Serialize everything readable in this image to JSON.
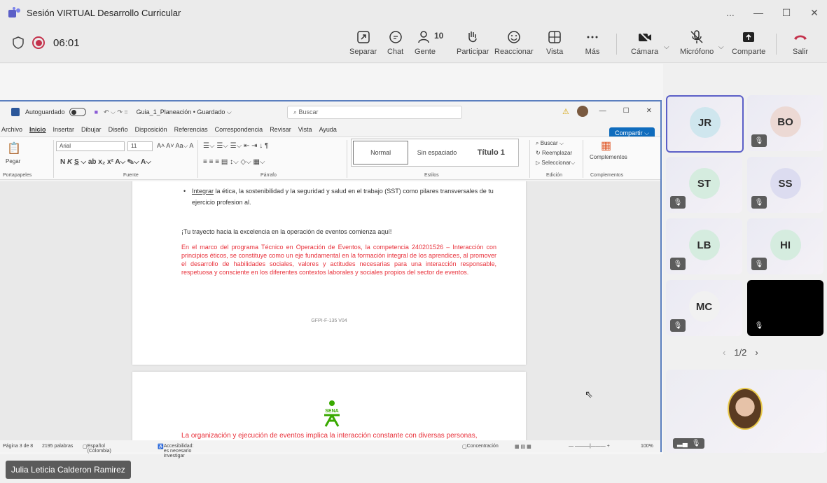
{
  "window": {
    "title": "Sesión VIRTUAL Desarrollo Curricular",
    "controls": [
      "...",
      "—",
      "☐",
      "✕"
    ]
  },
  "meeting": {
    "timer": "06:01",
    "buttons": {
      "separar": "Separar",
      "chat": "Chat",
      "gente": "Gente",
      "gente_count": "10",
      "participar": "Participar",
      "reaccionar": "Reaccionar",
      "vista": "Vista",
      "mas": "Más",
      "camara": "Cámara",
      "microfono": "Micrófono",
      "comparte": "Comparte",
      "salir": "Salir"
    }
  },
  "word": {
    "autosave": "Autoguardado",
    "doc_title": "Guia_1_Planeación • Guardado ⌵",
    "search_placeholder": "Buscar",
    "menu": [
      "Archivo",
      "Inicio",
      "Insertar",
      "Dibujar",
      "Diseño",
      "Disposición",
      "Referencias",
      "Correspondencia",
      "Revisar",
      "Vista",
      "Ayuda"
    ],
    "share": "Compartir",
    "ribbon": {
      "paste": "Pegar",
      "font": "Arial",
      "size": "11",
      "styles": [
        "Normal",
        "Sin espaciado",
        "Título 1"
      ],
      "search": "Buscar",
      "replace": "Reemplazar",
      "select": "Seleccionar",
      "addins": "Complementos",
      "groups": [
        "Portapapeles",
        "Fuente",
        "Párrafo",
        "Estilos",
        "Edición",
        "Complementos"
      ]
    },
    "doc": {
      "bullet_prefix": "Integrar",
      "bullet_text": "la ética, la sostenibilidad y la seguridad y salud en el trabajo (SST) como pilares transversales de tu ejercicio profesion al.",
      "tagline": "¡Tu trayecto hacia la excelencia en la operación de eventos comienza aquí!",
      "red_para": "En el marco del programa Técnico en Operación de Eventos, la competencia 240201526 – Interacción con principios éticos, se constituye como un eje fundamental en la formación integral de los aprendices, al promover el desarrollo de habilidades sociales, valores y actitudes necesarias para una interacción responsable, respetuosa y consciente en los diferentes contextos laborales y sociales propios del sector de eventos.",
      "footer_code": "GFPI-F-135 V04",
      "sena_logo": "SENA",
      "page2_text": "La organización y ejecución de eventos implica la interacción constante con diversas personas,"
    },
    "status": {
      "page": "Página 3 de 8",
      "words": "2195 palabras",
      "lang": "Español (Colombia)",
      "access": "Accesibilidad: es necesario investigar",
      "focus": "Concentración",
      "zoom": "100%"
    }
  },
  "presenter_name": "Julia Leticia Calderon Ramirez",
  "participants": [
    {
      "initials": "JR",
      "color": "#cfe6ee"
    },
    {
      "initials": "BO",
      "color": "#ecd9d4"
    },
    {
      "initials": "ST",
      "color": "#d5ecdf"
    },
    {
      "initials": "SS",
      "color": "#dcdcf0"
    },
    {
      "initials": "LB",
      "color": "#d5ecdf"
    },
    {
      "initials": "HI",
      "color": "#d5ecdf"
    },
    {
      "initials": "MC",
      "color": "#f1f1f1"
    }
  ],
  "pager": "1/2"
}
